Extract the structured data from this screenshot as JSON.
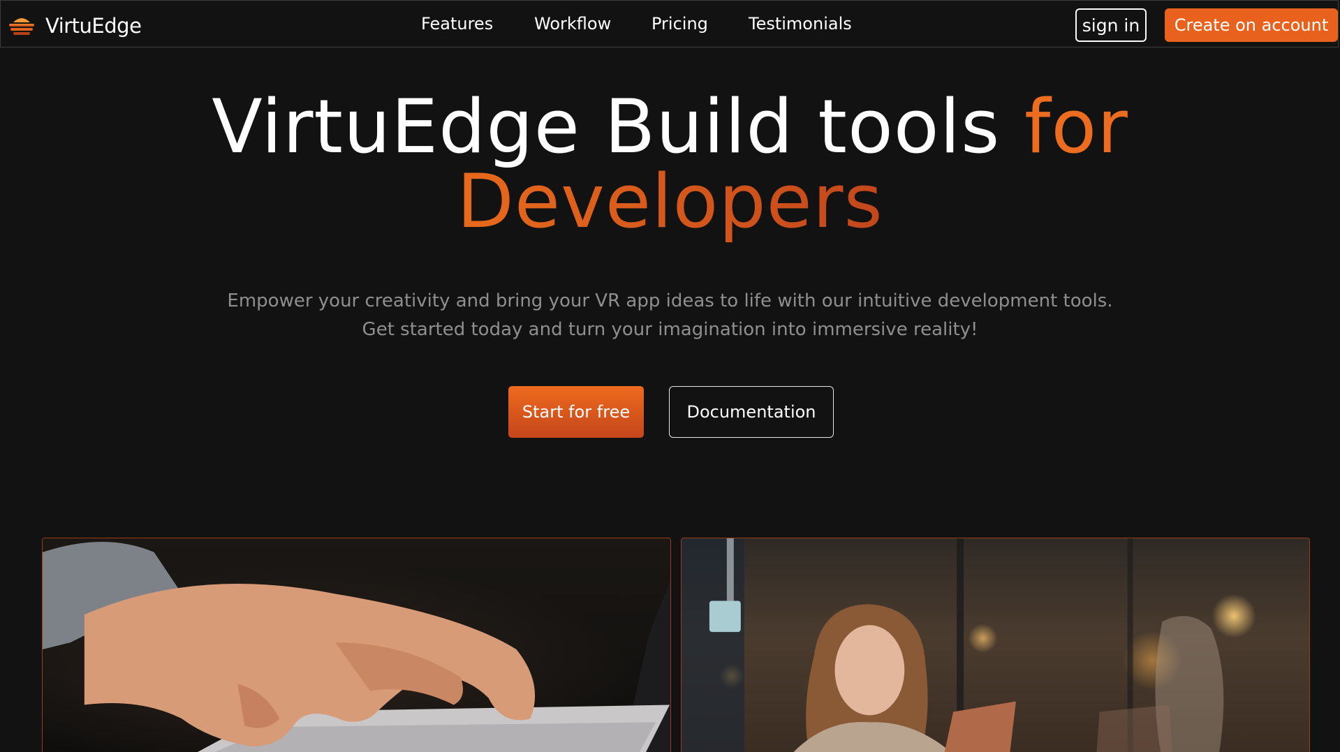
{
  "brand": {
    "name": "VirtuEdge",
    "logo_icon": "layered-disc-logo-icon"
  },
  "nav": {
    "links": [
      {
        "label": "Features"
      },
      {
        "label": "Workflow"
      },
      {
        "label": "Pricing"
      },
      {
        "label": "Testimonials"
      }
    ],
    "sign_in_label": "sign in",
    "create_account_label": "Create on account"
  },
  "hero": {
    "title_part1": "VirtuEdge Build tools ",
    "title_accent1": "for",
    "title_accent2": "Developers",
    "subtitle_line1": "Empower your creativity and bring your VR app ideas to life with our intuitive development tools.",
    "subtitle_line2": "Get started today and turn your imagination into immersive reality!",
    "primary_cta": "Start for free",
    "secondary_cta": "Documentation"
  },
  "cards": [
    {
      "image_description": "hands-typing-on-laptop-photo"
    },
    {
      "image_description": "woman-with-tablet-city-night-photo"
    }
  ],
  "colors": {
    "background": "#121212",
    "accent": "#e8621e",
    "accent_dark": "#c2471c",
    "subtitle_text": "#8f8f8f",
    "card_border": "#9a3e15"
  }
}
